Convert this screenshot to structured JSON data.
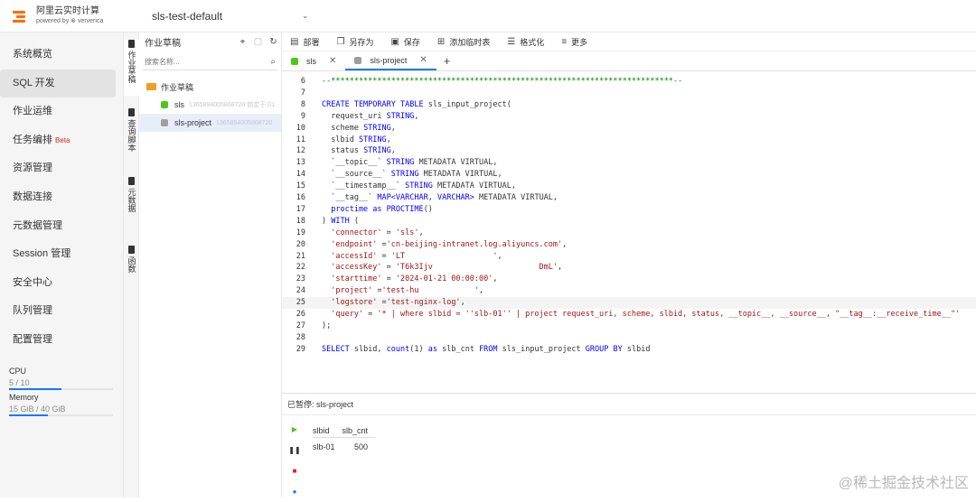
{
  "header": {
    "logo_line1": "阿里云实时计算",
    "logo_line2": "powered by ⊗ ververica",
    "workspace": "sls-test-default",
    "caret": "⌄"
  },
  "sidebar": {
    "items": [
      {
        "label": "系统概览"
      },
      {
        "label": "SQL 开发",
        "active": true
      },
      {
        "label": "作业运维"
      },
      {
        "label": "任务编排",
        "badge": "Beta"
      },
      {
        "label": "资源管理"
      },
      {
        "label": "数据连接"
      },
      {
        "label": "元数据管理"
      },
      {
        "label": "Session 管理"
      },
      {
        "label": "安全中心"
      },
      {
        "label": "队列管理"
      },
      {
        "label": "配置管理"
      }
    ],
    "resources": {
      "cpu_label": "CPU",
      "cpu_value": "5 / 10",
      "cpu_fraction": 0.5,
      "mem_label": "Memory",
      "mem_value": "15 GiB / 40 GiB",
      "mem_fraction": 0.375
    }
  },
  "vtabs": [
    "作业草稿",
    "查询脚本",
    "元数据",
    "函数"
  ],
  "filepanel": {
    "title": "作业草稿",
    "search_placeholder": "搜索名称...",
    "folder": "作业草稿",
    "files": [
      {
        "name": "sls",
        "meta": "1365894005868720 锁定于 01",
        "color": "#52c41a"
      },
      {
        "name": "sls-project",
        "meta": "1365894005868720",
        "color": "#9e9e9e",
        "active": true
      }
    ]
  },
  "toolbar": {
    "deploy": "部署",
    "save_as": "另存为",
    "save": "保存",
    "add_temp": "添加临时表",
    "format": "格式化",
    "more": "更多"
  },
  "tabs": [
    {
      "label": "sls",
      "color": "#52c41a"
    },
    {
      "label": "sls-project",
      "color": "#9e9e9e",
      "active": true
    }
  ],
  "editor": {
    "cursor_line": 25,
    "lines": [
      {
        "n": "6",
        "t": [
          [
            "cm",
            "--**************************************************************************--"
          ]
        ]
      },
      {
        "n": "7",
        "t": []
      },
      {
        "n": "8",
        "t": [
          [
            "kw",
            "CREATE TEMPORARY TABLE "
          ],
          [
            "",
            "sls_input_project("
          ]
        ]
      },
      {
        "n": "9",
        "t": [
          [
            "",
            "  request_uri "
          ],
          [
            "kw",
            "STRING"
          ],
          [
            "",
            ","
          ]
        ]
      },
      {
        "n": "10",
        "t": [
          [
            "",
            "  scheme "
          ],
          [
            "kw",
            "STRING"
          ],
          [
            "",
            ","
          ]
        ]
      },
      {
        "n": "11",
        "t": [
          [
            "",
            "  slbid "
          ],
          [
            "kw",
            "STRING"
          ],
          [
            "",
            ","
          ]
        ]
      },
      {
        "n": "12",
        "t": [
          [
            "",
            "  status "
          ],
          [
            "kw",
            "STRING"
          ],
          [
            "",
            ","
          ]
        ]
      },
      {
        "n": "13",
        "t": [
          [
            "",
            "  `__topic__` "
          ],
          [
            "kw",
            "STRING"
          ],
          [
            "",
            " METADATA VIRTUAL,"
          ]
        ]
      },
      {
        "n": "14",
        "t": [
          [
            "",
            "  `__source__` "
          ],
          [
            "kw",
            "STRING"
          ],
          [
            "",
            " METADATA VIRTUAL,"
          ]
        ]
      },
      {
        "n": "15",
        "t": [
          [
            "",
            "  `__timestamp__` "
          ],
          [
            "kw",
            "STRING"
          ],
          [
            "",
            " METADATA VIRTUAL,"
          ]
        ]
      },
      {
        "n": "16",
        "t": [
          [
            "",
            "  `__tag__` "
          ],
          [
            "kw",
            "MAP<VARCHAR"
          ],
          [
            "",
            ", "
          ],
          [
            "kw",
            "VARCHAR>"
          ],
          [
            "",
            " METADATA VIRTUAL,"
          ]
        ]
      },
      {
        "n": "17",
        "t": [
          [
            "kw",
            "  proctime as PROCTIME"
          ],
          [
            "",
            "()"
          ]
        ]
      },
      {
        "n": "18",
        "t": [
          [
            "",
            ") "
          ],
          [
            "kw",
            "WITH"
          ],
          [
            "",
            " ("
          ]
        ]
      },
      {
        "n": "19",
        "t": [
          [
            "str",
            "  'connector'"
          ],
          [
            "",
            " = "
          ],
          [
            "str",
            "'sls'"
          ],
          [
            "",
            ","
          ]
        ]
      },
      {
        "n": "20",
        "t": [
          [
            "str",
            "  'endpoint'"
          ],
          [
            "",
            " ="
          ],
          [
            "str",
            "'cn-beijing-intranet.log.aliyuncs.com'"
          ],
          [
            "",
            ","
          ]
        ]
      },
      {
        "n": "21",
        "t": [
          [
            "str",
            "  'accessId'"
          ],
          [
            "",
            " = "
          ],
          [
            "str",
            "'LT                   '"
          ],
          [
            "",
            ","
          ]
        ]
      },
      {
        "n": "22",
        "t": [
          [
            "str",
            "  'accessKey'"
          ],
          [
            "",
            " = "
          ],
          [
            "str",
            "'T6k3Ijv                       DmL'"
          ],
          [
            "",
            ","
          ]
        ]
      },
      {
        "n": "23",
        "t": [
          [
            "str",
            "  'starttime'"
          ],
          [
            "",
            " = "
          ],
          [
            "str",
            "'2024-01-21 00:00:00'"
          ],
          [
            "",
            ","
          ]
        ]
      },
      {
        "n": "24",
        "t": [
          [
            "str",
            "  'project'"
          ],
          [
            "",
            " ="
          ],
          [
            "str",
            "'test-hu            '"
          ],
          [
            "",
            ","
          ]
        ]
      },
      {
        "n": "25",
        "t": [
          [
            "str",
            "  'logstore'"
          ],
          [
            "",
            " ="
          ],
          [
            "str",
            "'test-nginx-log'"
          ],
          [
            "",
            ","
          ]
        ]
      },
      {
        "n": "26",
        "t": [
          [
            "str",
            "  'query'"
          ],
          [
            "",
            " = "
          ],
          [
            "str",
            "'* | where slbid = ''slb-01'' | project request_uri, scheme, slbid, status, __topic__, __source__, \"__tag__:__receive_time__\"'"
          ]
        ]
      },
      {
        "n": "27",
        "t": [
          [
            "",
            ");"
          ]
        ]
      },
      {
        "n": "28",
        "t": []
      },
      {
        "n": "29",
        "t": [
          [
            "kw",
            "SELECT"
          ],
          [
            "",
            " slbid, "
          ],
          [
            "kw",
            "count"
          ],
          [
            "",
            "(1) "
          ],
          [
            "kw",
            "as"
          ],
          [
            "",
            " slb_cnt "
          ],
          [
            "kw",
            "FROM"
          ],
          [
            "",
            " sls_input_project "
          ],
          [
            "kw",
            "GROUP BY"
          ],
          [
            "",
            " slbid"
          ]
        ]
      }
    ]
  },
  "results": {
    "status": "已暂停: sls-project",
    "columns": [
      "slbid",
      "slb_cnt"
    ],
    "rows": [
      [
        "slb-01",
        "500"
      ]
    ]
  },
  "watermark": "@稀土掘金技术社区",
  "colors": {
    "accent": "#1677ff",
    "brand": "#ff6a00"
  }
}
